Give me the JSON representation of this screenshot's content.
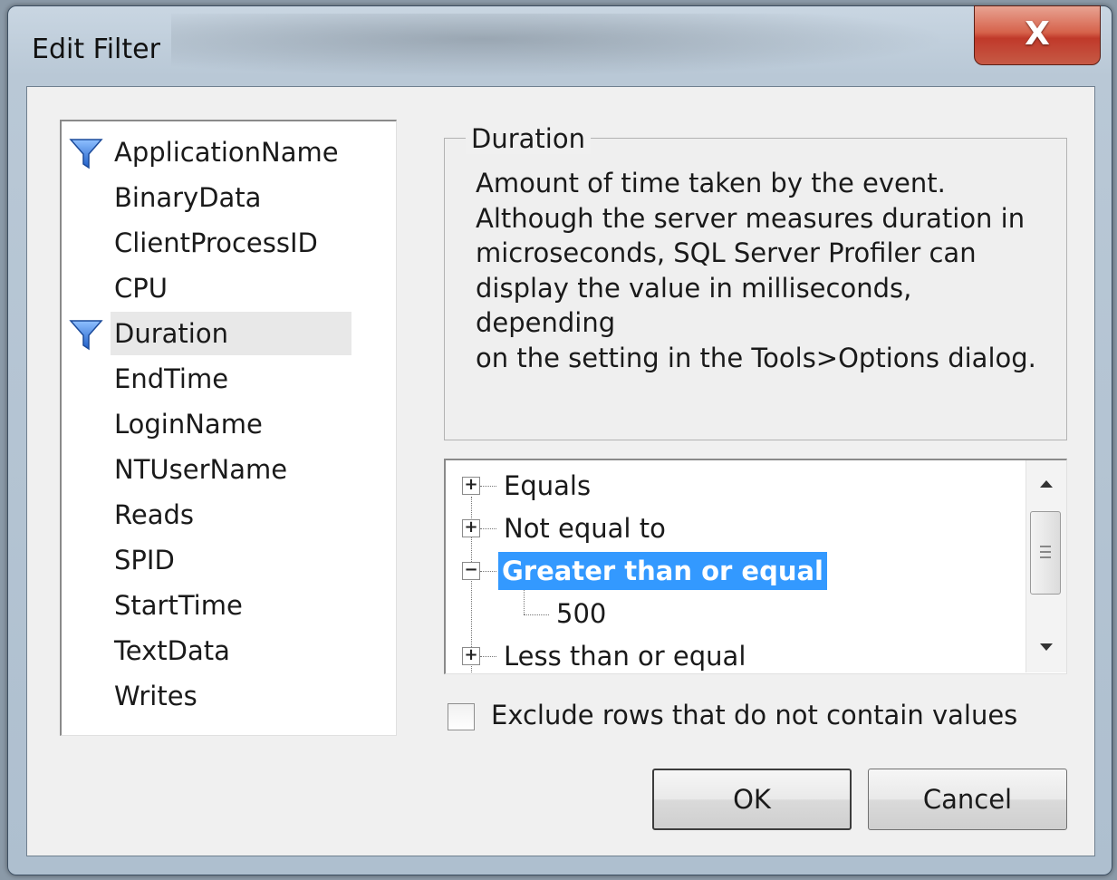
{
  "window": {
    "title": "Edit Filter",
    "close_glyph": "X"
  },
  "columns": {
    "items": [
      {
        "label": "ApplicationName",
        "filtered": true,
        "selected": false
      },
      {
        "label": "BinaryData",
        "filtered": false,
        "selected": false
      },
      {
        "label": "ClientProcessID",
        "filtered": false,
        "selected": false
      },
      {
        "label": "CPU",
        "filtered": false,
        "selected": false
      },
      {
        "label": "Duration",
        "filtered": true,
        "selected": true
      },
      {
        "label": "EndTime",
        "filtered": false,
        "selected": false
      },
      {
        "label": "LoginName",
        "filtered": false,
        "selected": false
      },
      {
        "label": "NTUserName",
        "filtered": false,
        "selected": false
      },
      {
        "label": "Reads",
        "filtered": false,
        "selected": false
      },
      {
        "label": "SPID",
        "filtered": false,
        "selected": false
      },
      {
        "label": "StartTime",
        "filtered": false,
        "selected": false
      },
      {
        "label": "TextData",
        "filtered": false,
        "selected": false
      },
      {
        "label": "Writes",
        "filtered": false,
        "selected": false
      }
    ]
  },
  "description": {
    "heading": "Duration",
    "lines": [
      "Amount of time taken by the event.",
      "Although the server measures duration in",
      "microseconds, SQL Server Profiler can",
      "display the value in milliseconds, depending",
      "on the setting in the Tools>Options dialog."
    ]
  },
  "conditions": {
    "nodes": [
      {
        "label": "Equals",
        "expander": "+"
      },
      {
        "label": "Not equal to",
        "expander": "+"
      },
      {
        "label": "Greater than or equal",
        "expander": "−",
        "selected": true
      },
      {
        "label": "500",
        "child": true
      },
      {
        "label": "Less than or equal",
        "expander": "+"
      }
    ]
  },
  "options": {
    "exclude_label": "Exclude rows that do not contain values",
    "exclude_checked": false
  },
  "buttons": {
    "ok": "OK",
    "cancel": "Cancel"
  },
  "colors": {
    "selection": "#3399ff",
    "filter_icon": "#2f6fd6",
    "close_button": "#c0392a"
  }
}
